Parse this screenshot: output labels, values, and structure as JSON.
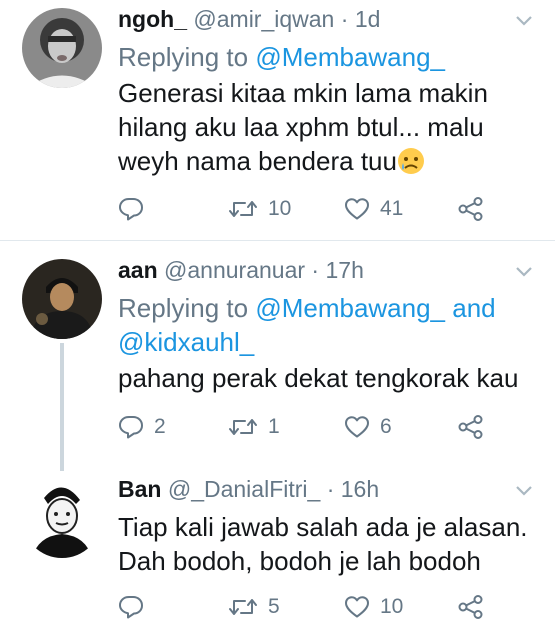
{
  "tweets": [
    {
      "name": "ngoh_",
      "handle": "@amir_iqwan",
      "separator": "·",
      "time": "1d",
      "replying_prefix": "Replying to",
      "replying_to": "@Membawang_",
      "replying_and": "",
      "replying_to_2": "",
      "text_lines": [
        "Generasi kitaa mkin lama makin",
        "hilang aku laa xphm btul... malu",
        "weyh nama bendera tuu"
      ],
      "reply_count": "",
      "retweet_count": "10",
      "like_count": "41"
    },
    {
      "name": "aan",
      "handle": "@annuranuar",
      "separator": "·",
      "time": "17h",
      "replying_prefix": "Replying to",
      "replying_to": "@Membawang_",
      "replying_and": "and",
      "replying_to_2": "@kidxauhl_",
      "text_lines": [
        "pahang perak dekat tengkorak kau"
      ],
      "reply_count": "2",
      "retweet_count": "1",
      "like_count": "6"
    },
    {
      "name": "Ban",
      "handle": "@_DanialFitri_",
      "separator": "·",
      "time": "16h",
      "text_lines": [
        "Tiap kali jawab salah ada je alasan.",
        "Dah bodoh, bodoh je lah bodoh"
      ],
      "reply_count": "",
      "retweet_count": "5",
      "like_count": "10"
    }
  ],
  "colors": {
    "link": "#1b95e0",
    "muted": "#657786",
    "divider": "#e1e8ed"
  },
  "icons": [
    "chevron-down-icon",
    "reply-icon",
    "retweet-icon",
    "like-icon",
    "share-icon",
    "sad-tear-emoji"
  ]
}
